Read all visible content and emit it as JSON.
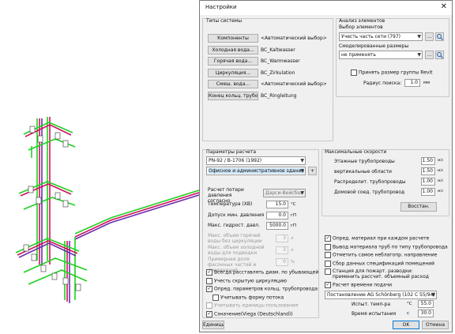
{
  "dialog": {
    "title": "Настройки",
    "close_glyph": "✕"
  },
  "system_types": {
    "legend": "Типы системы",
    "rows": [
      {
        "button": "Компоненты",
        "value": "<Автоматический выбор>"
      },
      {
        "button": "Холодная вода...",
        "value": "BC_Kaltwasser"
      },
      {
        "button": "Горячая вода...",
        "value": "BC_Warmwasser"
      },
      {
        "button": "Циркуляция...",
        "value": "BC_Zirkulation"
      },
      {
        "button": "Смеш. вода...",
        "value": "<Автоматический выбор>"
      },
      {
        "button": "Конец кольц. трубопр...",
        "value": "BC_Ringleitung"
      }
    ]
  },
  "analysis": {
    "legend": "Анализ элементов",
    "selection_label": "Выбор элементов",
    "selection_value": "Учесть часть сети (797)",
    "modeled_label": "Смоделированные размеры",
    "modeled_value": "не применять",
    "more_label": "...",
    "revit_group_label": "Принять размер группы Revit",
    "search_radius_label": "Радиус поиска:",
    "search_radius_value": "1.0",
    "search_radius_unit": "мм"
  },
  "calc": {
    "legend": "Параметры расчета",
    "norm_value": "PN-92 / B-1706 (1992)",
    "building_value": "Офисное и административное здание",
    "plus_label": "+",
    "pressure_loss_label": "Расчет потери давления согласно",
    "pressure_loss_value": "Дарси-Вейсбах",
    "temp_label": "Температура (ХВ)",
    "temp_value": "15.0",
    "temp_unit": "°C",
    "tol_label": "Допуск мин. давления",
    "tol_value": "0.0",
    "tol_unit": "гП",
    "maxp_label": "Макс. гидрост. давл.",
    "maxp_value": "5000.0",
    "maxp_unit": "гП",
    "hot_flow_label": "Макс. объем горячей воды без циркуляции",
    "hot_flow_value": "3",
    "hot_flow_unit": "л",
    "cold_flow_label": "Макс. объем холодной воды для подводки",
    "cold_flow_value": "3",
    "cold_flow_unit": "л",
    "share_label": "Примерная доля фасонных частей и соединений",
    "share_value": "0",
    "share_unit": "%"
  },
  "calc_checks": [
    {
      "label": "Всегда расставлять диам. по убывающей",
      "checked": true,
      "disabled": false
    },
    {
      "label": "Учесть скрытую циркуляцию",
      "checked": false,
      "disabled": false
    },
    {
      "label": "Опред. параметров кольц. трубопровода",
      "checked": true,
      "disabled": false
    },
    {
      "label": "Учитывать форму потока",
      "checked": false,
      "disabled": false
    },
    {
      "label": "Учитывать единицы пользования",
      "checked": false,
      "disabled": true
    },
    {
      "label": "Сэначение(Viega (Deutschland))",
      "checked": true,
      "disabled": false
    }
  ],
  "velocities": {
    "legend": "Максимальные скорости",
    "rows": [
      {
        "label": "Этажные трубопроводы",
        "value": "1.50",
        "unit": "м/с"
      },
      {
        "label": "вертикальные области",
        "value": "1.50",
        "unit": "м/с"
      },
      {
        "label": "Распределит. трубопроводы",
        "value": "1.00",
        "unit": "м/с"
      },
      {
        "label": "Домовой соед. трубопровод",
        "value": "1.00",
        "unit": "м/с"
      }
    ],
    "restore_label": "Восстан."
  },
  "right_checks": [
    {
      "label": "Опред. материал при каждом расчете",
      "checked": true
    },
    {
      "label": "Вывод материала труб по типу трубопровода",
      "checked": false
    },
    {
      "label": "Отметить самое неблагопр. направление",
      "checked": false
    },
    {
      "label": "Сбор данных спецификаций помещений",
      "checked": false
    },
    {
      "label": "Станция для пожарт. разводки: применить рассчит. объемный расход",
      "checked": false
    },
    {
      "label": "Расчет времени подачи",
      "checked": true
    }
  ],
  "supply": {
    "combo_value": "Постановление AG Schönberg (102 С 55/94)",
    "test_temp_label": "Испыт. темп-ра",
    "test_temp_unit": "°C",
    "test_temp_value": "55.0",
    "test_time_label": "Время испытания",
    "test_time_unit": "с",
    "test_time_value": "30.0"
  },
  "footer": {
    "units_label": "Единицы...",
    "ok_label": "OK",
    "cancel_label": "Отмена"
  },
  "colors": {
    "cold": "#20d020",
    "hot": "#d01060",
    "circ": "#6a2fb0",
    "ring": "#2030d0"
  }
}
